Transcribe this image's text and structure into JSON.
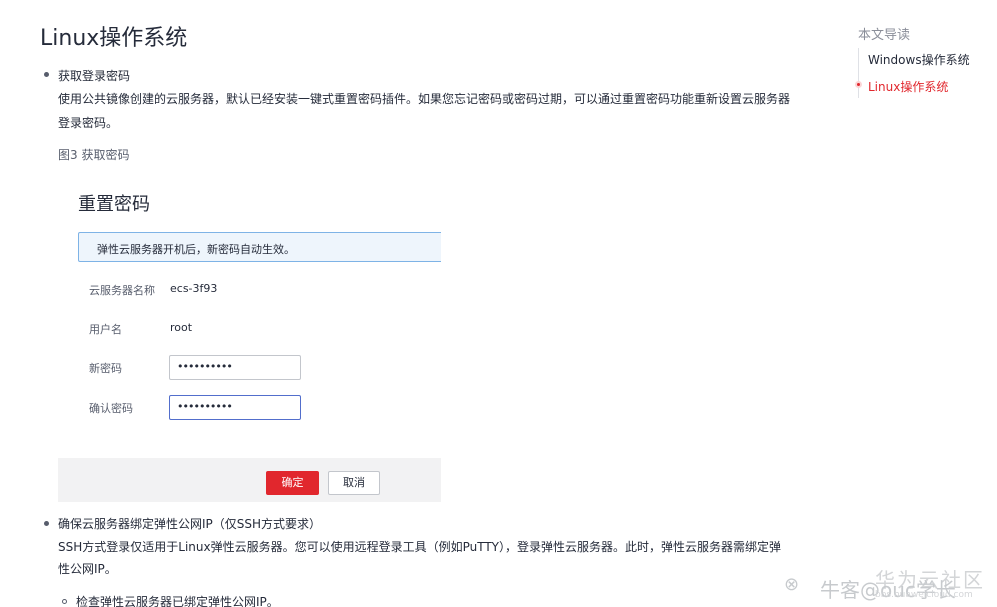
{
  "page_title": "Linux操作系统",
  "sections": [
    {
      "title": "获取登录密码",
      "body_line1": "使用公共镜像创建的云服务器，默认已经安装一键式重置密码插件。如果您忘记密码或密码过期，可以通过重置密码功能重新设置云服务器",
      "body_line2": "登录密码。"
    },
    {
      "title": "确保云服务器绑定弹性公网IP（仅SSH方式要求）",
      "body_line1": "SSH方式登录仅适用于Linux弹性云服务器。您可以使用远程登录工具（例如PuTTY），登录弹性云服务器。此时，弹性云服务器需绑定弹",
      "body_line2": "性公网IP。"
    }
  ],
  "figure_caption": "图3 获取密码",
  "dialog": {
    "title": "重置密码",
    "notice": "弹性云服务器开机后，新密码自动生效。",
    "fields": [
      {
        "label": "云服务器名称",
        "value": "ecs-3f93"
      },
      {
        "label": "用户名",
        "value": "root"
      },
      {
        "label": "新密码",
        "value": "••••••••••"
      },
      {
        "label": "确认密码",
        "value": "••••••••••"
      }
    ],
    "confirm_label": "确定",
    "cancel_label": "取消"
  },
  "sub_item": "检查弹性云服务器已绑定弹性公网IP。",
  "toc": {
    "title": "本文导读",
    "items": [
      {
        "label": "Windows操作系统",
        "active": false
      },
      {
        "label": "Linux操作系统",
        "active": true
      }
    ]
  },
  "watermark": {
    "brand": "华为云社区",
    "handle": "牛客@ouc学长",
    "url": "bbs.huaweicloud.com"
  },
  "colors": {
    "accent_red": "#e1272d",
    "notice_border": "#7eb3e6",
    "text_primary": "#252b3a"
  }
}
